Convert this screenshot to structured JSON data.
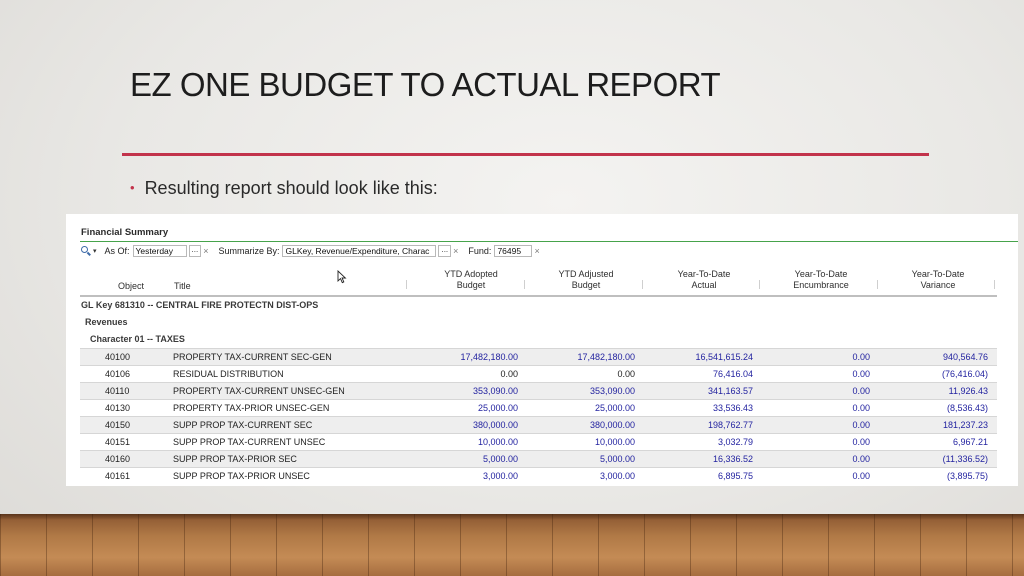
{
  "slide": {
    "title": "EZ ONE BUDGET TO ACTUAL REPORT",
    "bullet": "Resulting report should look like this:"
  },
  "report": {
    "section_title": "Financial Summary",
    "toolbar": {
      "as_of_label": "As Of:",
      "as_of_value": "Yesterday",
      "summarize_label": "Summarize By:",
      "summarize_value": "GLKey, Revenue/Expenditure, Charac",
      "fund_label": "Fund:",
      "fund_value": "76495",
      "more": "...",
      "clear": "×",
      "caret": "▾"
    },
    "columns": {
      "object": "Object",
      "title": "Title",
      "ytd_adopted": [
        "YTD Adopted",
        "Budget"
      ],
      "ytd_adjusted": [
        "YTD Adjusted",
        "Budget"
      ],
      "ytd_actual": [
        "Year-To-Date",
        "Actual"
      ],
      "ytd_encumbrance": [
        "Year-To-Date",
        "Encumbrance"
      ],
      "ytd_variance": [
        "Year-To-Date",
        "Variance"
      ]
    },
    "gl_key": "GL Key 681310 -- CENTRAL FIRE PROTECTN DIST-OPS",
    "group": "Revenues",
    "character": "Character 01 -- TAXES",
    "rows": [
      {
        "object": "40100",
        "title": "PROPERTY TAX-CURRENT SEC-GEN",
        "adopted": "17,482,180.00",
        "adjusted": "17,482,180.00",
        "actual": "16,541,615.24",
        "encumbrance": "0.00",
        "variance": "940,564.76"
      },
      {
        "object": "40106",
        "title": "RESIDUAL DISTRIBUTION",
        "adopted": "0.00",
        "adjusted": "0.00",
        "actual": "76,416.04",
        "encumbrance": "0.00",
        "variance": "(76,416.04)"
      },
      {
        "object": "40110",
        "title": "PROPERTY TAX-CURRENT UNSEC-GEN",
        "adopted": "353,090.00",
        "adjusted": "353,090.00",
        "actual": "341,163.57",
        "encumbrance": "0.00",
        "variance": "11,926.43"
      },
      {
        "object": "40130",
        "title": "PROPERTY TAX-PRIOR UNSEC-GEN",
        "adopted": "25,000.00",
        "adjusted": "25,000.00",
        "actual": "33,536.43",
        "encumbrance": "0.00",
        "variance": "(8,536.43)"
      },
      {
        "object": "40150",
        "title": "SUPP PROP TAX-CURRENT SEC",
        "adopted": "380,000.00",
        "adjusted": "380,000.00",
        "actual": "198,762.77",
        "encumbrance": "0.00",
        "variance": "181,237.23"
      },
      {
        "object": "40151",
        "title": "SUPP PROP TAX-CURRENT UNSEC",
        "adopted": "10,000.00",
        "adjusted": "10,000.00",
        "actual": "3,032.79",
        "encumbrance": "0.00",
        "variance": "6,967.21"
      },
      {
        "object": "40160",
        "title": "SUPP PROP TAX-PRIOR SEC",
        "adopted": "5,000.00",
        "adjusted": "5,000.00",
        "actual": "16,336.52",
        "encumbrance": "0.00",
        "variance": "(11,336.52)"
      },
      {
        "object": "40161",
        "title": "SUPP PROP TAX-PRIOR UNSEC",
        "adopted": "3,000.00",
        "adjusted": "3,000.00",
        "actual": "6,895.75",
        "encumbrance": "0.00",
        "variance": "(3,895.75)"
      }
    ]
  },
  "colors": {
    "accent_rule": "#c2334b",
    "header_green": "#46a34b",
    "link_blue": "#2323a0"
  },
  "icons": [
    "search-icon",
    "mouse-cursor-icon"
  ]
}
